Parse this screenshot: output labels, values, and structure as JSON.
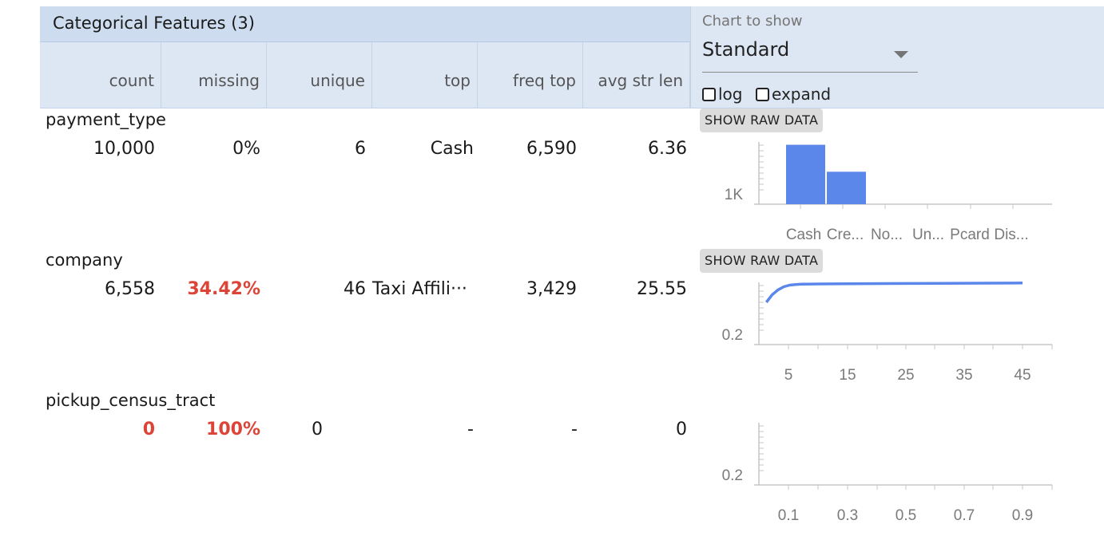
{
  "header": {
    "title": "Categorical Features (3)",
    "columns": [
      "count",
      "missing",
      "unique",
      "top",
      "freq top",
      "avg str len"
    ]
  },
  "controls": {
    "chart_label": "Chart to show",
    "chart_selected": "Standard",
    "log_label": "log",
    "expand_label": "expand",
    "log_checked": false,
    "expand_checked": false
  },
  "show_raw_label": "SHOW RAW DATA",
  "features": [
    {
      "name": "payment_type",
      "count": "10,000",
      "missing": "0%",
      "unique": "6",
      "top": "Cash",
      "freq_top": "6,590",
      "avg_str_len": "6.36"
    },
    {
      "name": "company",
      "count": "6,558",
      "missing": "34.42%",
      "unique": "46",
      "top": "Taxi Affili···",
      "freq_top": "3,429",
      "avg_str_len": "25.55"
    },
    {
      "name": "pickup_census_tract",
      "count": "0",
      "missing": "100%",
      "unique": "0",
      "top": "-",
      "freq_top": "-",
      "avg_str_len": "0"
    }
  ],
  "colors": {
    "bar": "#5b87ea",
    "alert": "#db4437",
    "header_bg": "#dde7f3",
    "title_bg": "#cddcef"
  },
  "chart_data": [
    {
      "type": "bar",
      "categories": [
        "Cash",
        "Cre...",
        "No...",
        "Un...",
        "Pcard",
        "Dis..."
      ],
      "values": [
        6590,
        2800,
        0,
        0,
        0,
        0
      ],
      "ytick_label": "1K",
      "scale": "log"
    },
    {
      "type": "line",
      "x": [
        1,
        2,
        3,
        4,
        5,
        6,
        7,
        10,
        15,
        25,
        35,
        45
      ],
      "y": [
        0.68,
        0.8,
        0.88,
        0.93,
        0.955,
        0.965,
        0.97,
        0.975,
        0.978,
        0.982,
        0.986,
        0.99
      ],
      "xticks": [
        "5",
        "15",
        "25",
        "35",
        "45"
      ],
      "ytick_label": "0.2"
    },
    {
      "type": "line",
      "x": [],
      "y": [],
      "xticks": [
        "0.1",
        "0.3",
        "0.5",
        "0.7",
        "0.9"
      ],
      "ytick_label": "0.2"
    }
  ]
}
